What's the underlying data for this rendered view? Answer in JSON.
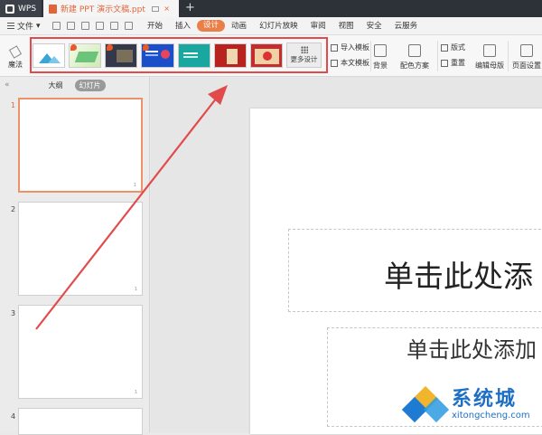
{
  "titlebar": {
    "app_tab": "WPS",
    "doc_tab": "新建 PPT 演示文稿.ppt",
    "close_glyph": "×",
    "new_tab_glyph": "+"
  },
  "menubar": {
    "file_label": "文件",
    "dropdown_glyph": "▾",
    "tabs": [
      "开始",
      "插入",
      "设计",
      "动画",
      "幻灯片放映",
      "审阅",
      "视图",
      "安全",
      "云服务"
    ],
    "active_tab": "设计"
  },
  "ribbon": {
    "beautify_label": "魔法",
    "gallery_more_label": "更多设计",
    "import_template": "导入模板",
    "this_doc_template": "本文模板",
    "background": "背景",
    "color_scheme": "配色方案",
    "layout": "版式",
    "reset": "重置",
    "edit_master": "编辑母版",
    "page_setup": "页面设置"
  },
  "sidebar": {
    "collapse_glyph": "«",
    "tab_outline": "大纲",
    "tab_slides": "幻灯片",
    "slide_numbers": [
      "1",
      "2",
      "3",
      "4"
    ],
    "selected_slide": "1"
  },
  "slide": {
    "title_placeholder": "单击此处添",
    "subtitle_placeholder": "单击此处添加"
  },
  "watermark": {
    "name": "系统城",
    "url": "xitongcheng.com"
  },
  "colors": {
    "accent": "#e9804a",
    "annotation_red": "#e24b4b",
    "titlebar": "#2d3138"
  }
}
